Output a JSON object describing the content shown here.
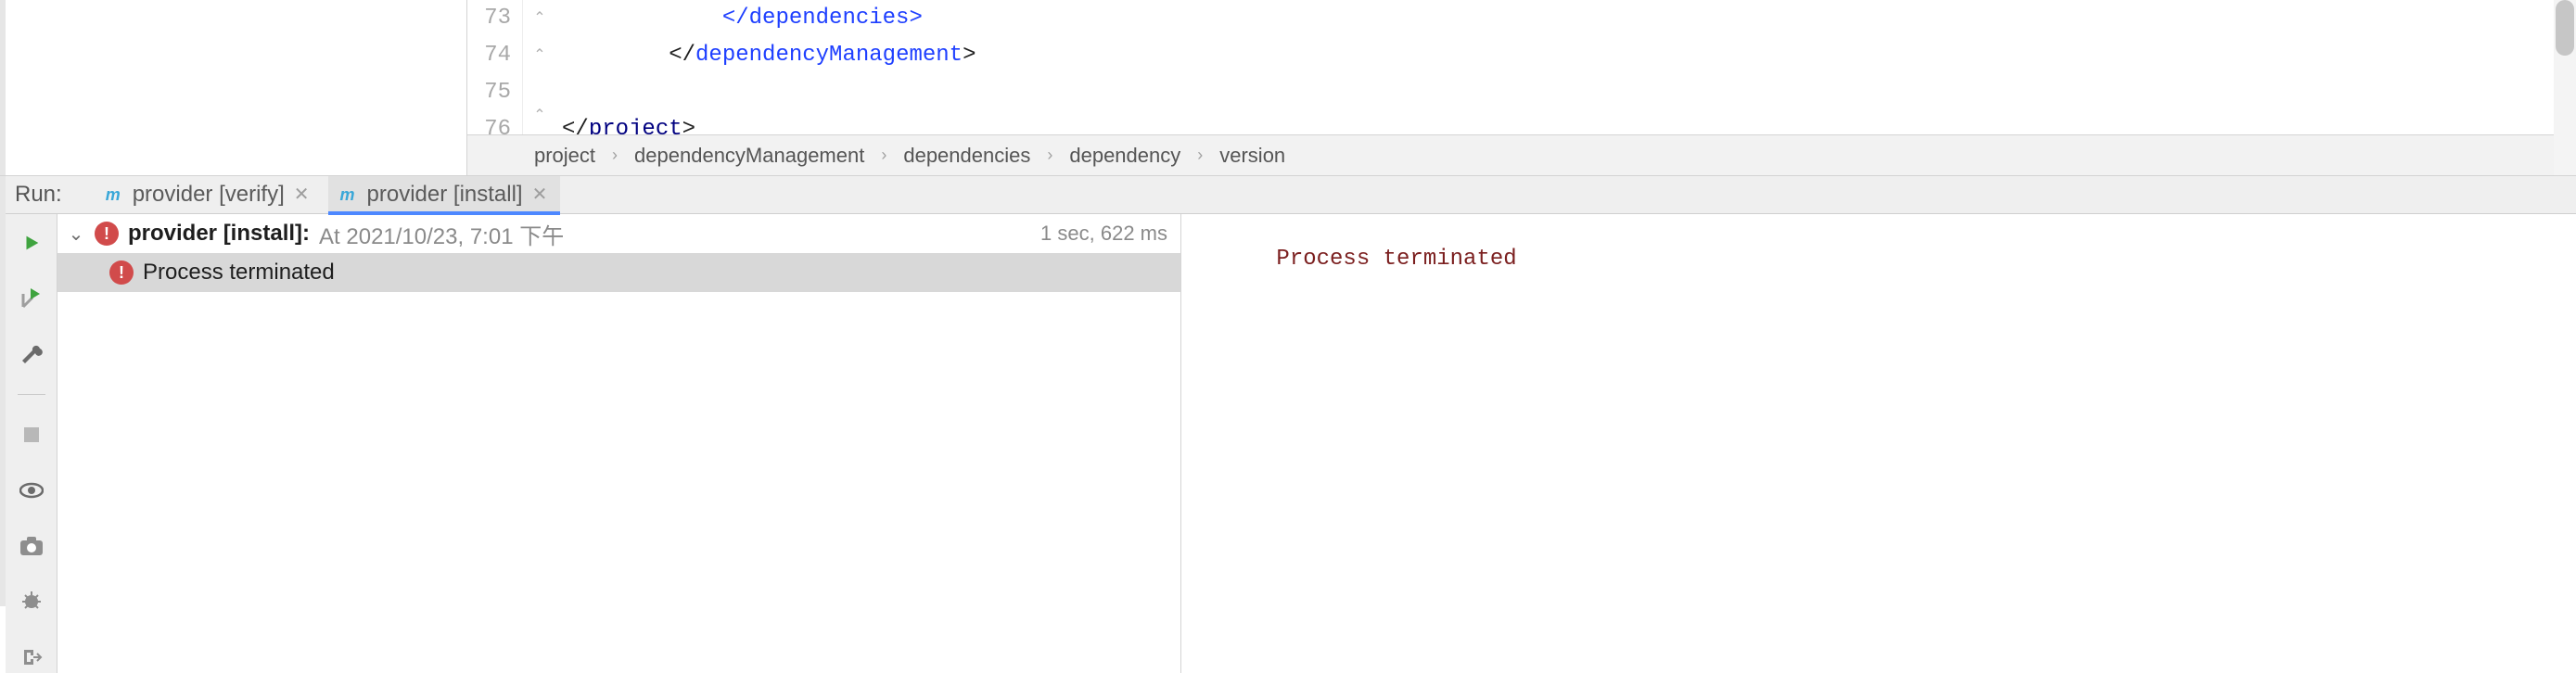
{
  "editor": {
    "gutter": [
      "73",
      "74",
      "75",
      "76"
    ],
    "lines": {
      "l73": "            </dependencies>",
      "l74_pre": "        </",
      "l74_name": "dependencyManagement",
      "l74_post": ">",
      "l76_pre": "</",
      "l76_name": "project",
      "l76_post": ">"
    },
    "breadcrumb": [
      "project",
      "dependencyManagement",
      "dependencies",
      "dependency",
      "version"
    ]
  },
  "run": {
    "label": "Run:",
    "tabs": [
      {
        "icon": "m",
        "label": "provider [verify]"
      },
      {
        "icon": "m",
        "label": "provider [install]"
      }
    ],
    "tree": {
      "root_title": "provider [install]:",
      "root_sub": "At 2021/10/23, 7:01 下午",
      "root_time": "1 sec, 622 ms",
      "child_label": "Process terminated"
    },
    "console": "Process terminated"
  }
}
